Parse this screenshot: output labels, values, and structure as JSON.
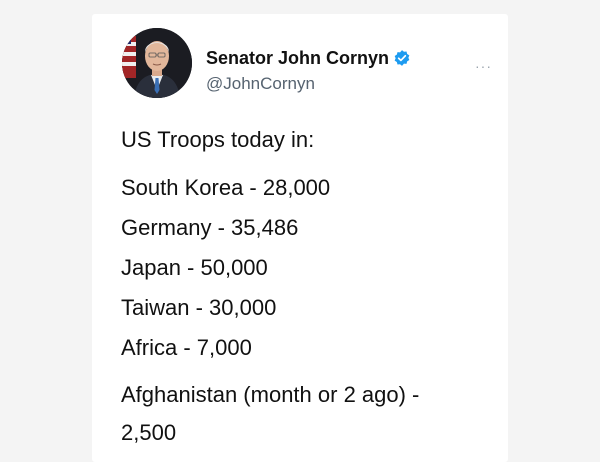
{
  "tweet": {
    "author": {
      "display_name": "Senator John Cornyn",
      "handle": "@JohnCornyn",
      "verified": true,
      "avatar_icon": "portrait-avatar",
      "verified_icon": "verified-badge-icon"
    },
    "more_menu_label": "···",
    "text": {
      "intro": "US Troops today in:",
      "lines": [
        "South Korea - 28,000",
        "Germany - 35,486",
        "Japan - 50,000",
        "Taiwan - 30,000",
        "Africa - 7,000"
      ],
      "last_line_1": "Afghanistan (month or 2 ago) -",
      "last_line_2": "2,500"
    }
  },
  "colors": {
    "accent": "#1d9bf0",
    "text_primary": "#111111",
    "text_secondary": "#566370",
    "background": "#f4f4f4"
  }
}
